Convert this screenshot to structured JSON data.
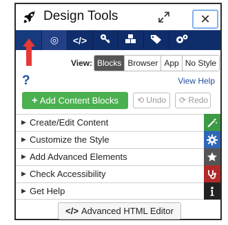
{
  "window": {
    "title": "Design Tools",
    "close_label": "✕"
  },
  "toolbar": {
    "tabs": [
      {
        "icon": "rocket-icon"
      },
      {
        "icon": "target-icon",
        "glyph": "◎"
      },
      {
        "icon": "code-icon",
        "glyph": "</>"
      },
      {
        "icon": "key-icon"
      },
      {
        "icon": "cubes-icon"
      },
      {
        "icon": "tags-icon"
      },
      {
        "icon": "gears-icon"
      }
    ],
    "background_color": "#0f2d6b"
  },
  "view": {
    "label": "View:",
    "options": [
      "Blocks",
      "Browser",
      "App",
      "No Style"
    ],
    "selected": "Blocks"
  },
  "help": {
    "question_mark": "?",
    "view_help": "View Help"
  },
  "actions": {
    "add_content_blocks": "Add Content Blocks",
    "add_icon_glyph": "+",
    "undo": "Undo",
    "redo": "Redo",
    "add_color": "#4bb04f"
  },
  "accordion": {
    "items": [
      {
        "label": "Create/Edit Content",
        "side_icon": "magic-wand-icon",
        "side_color": "#3c9a44"
      },
      {
        "label": "Customize the Style",
        "side_icon": "gear-icon",
        "side_color": "#2f67b8"
      },
      {
        "label": "Add Advanced Elements",
        "side_icon": "star-icon",
        "side_color": "#555555"
      },
      {
        "label": "Check Accessibility",
        "side_icon": "stethoscope-icon",
        "side_color": "#b22a2a"
      },
      {
        "label": "Get Help",
        "side_icon": "info-icon",
        "side_color": "#222222"
      }
    ]
  },
  "footer": {
    "advanced_html_editor": "Advanced HTML Editor",
    "code_glyph": "</>"
  },
  "annotation": {
    "arrow_color": "#e53935"
  }
}
